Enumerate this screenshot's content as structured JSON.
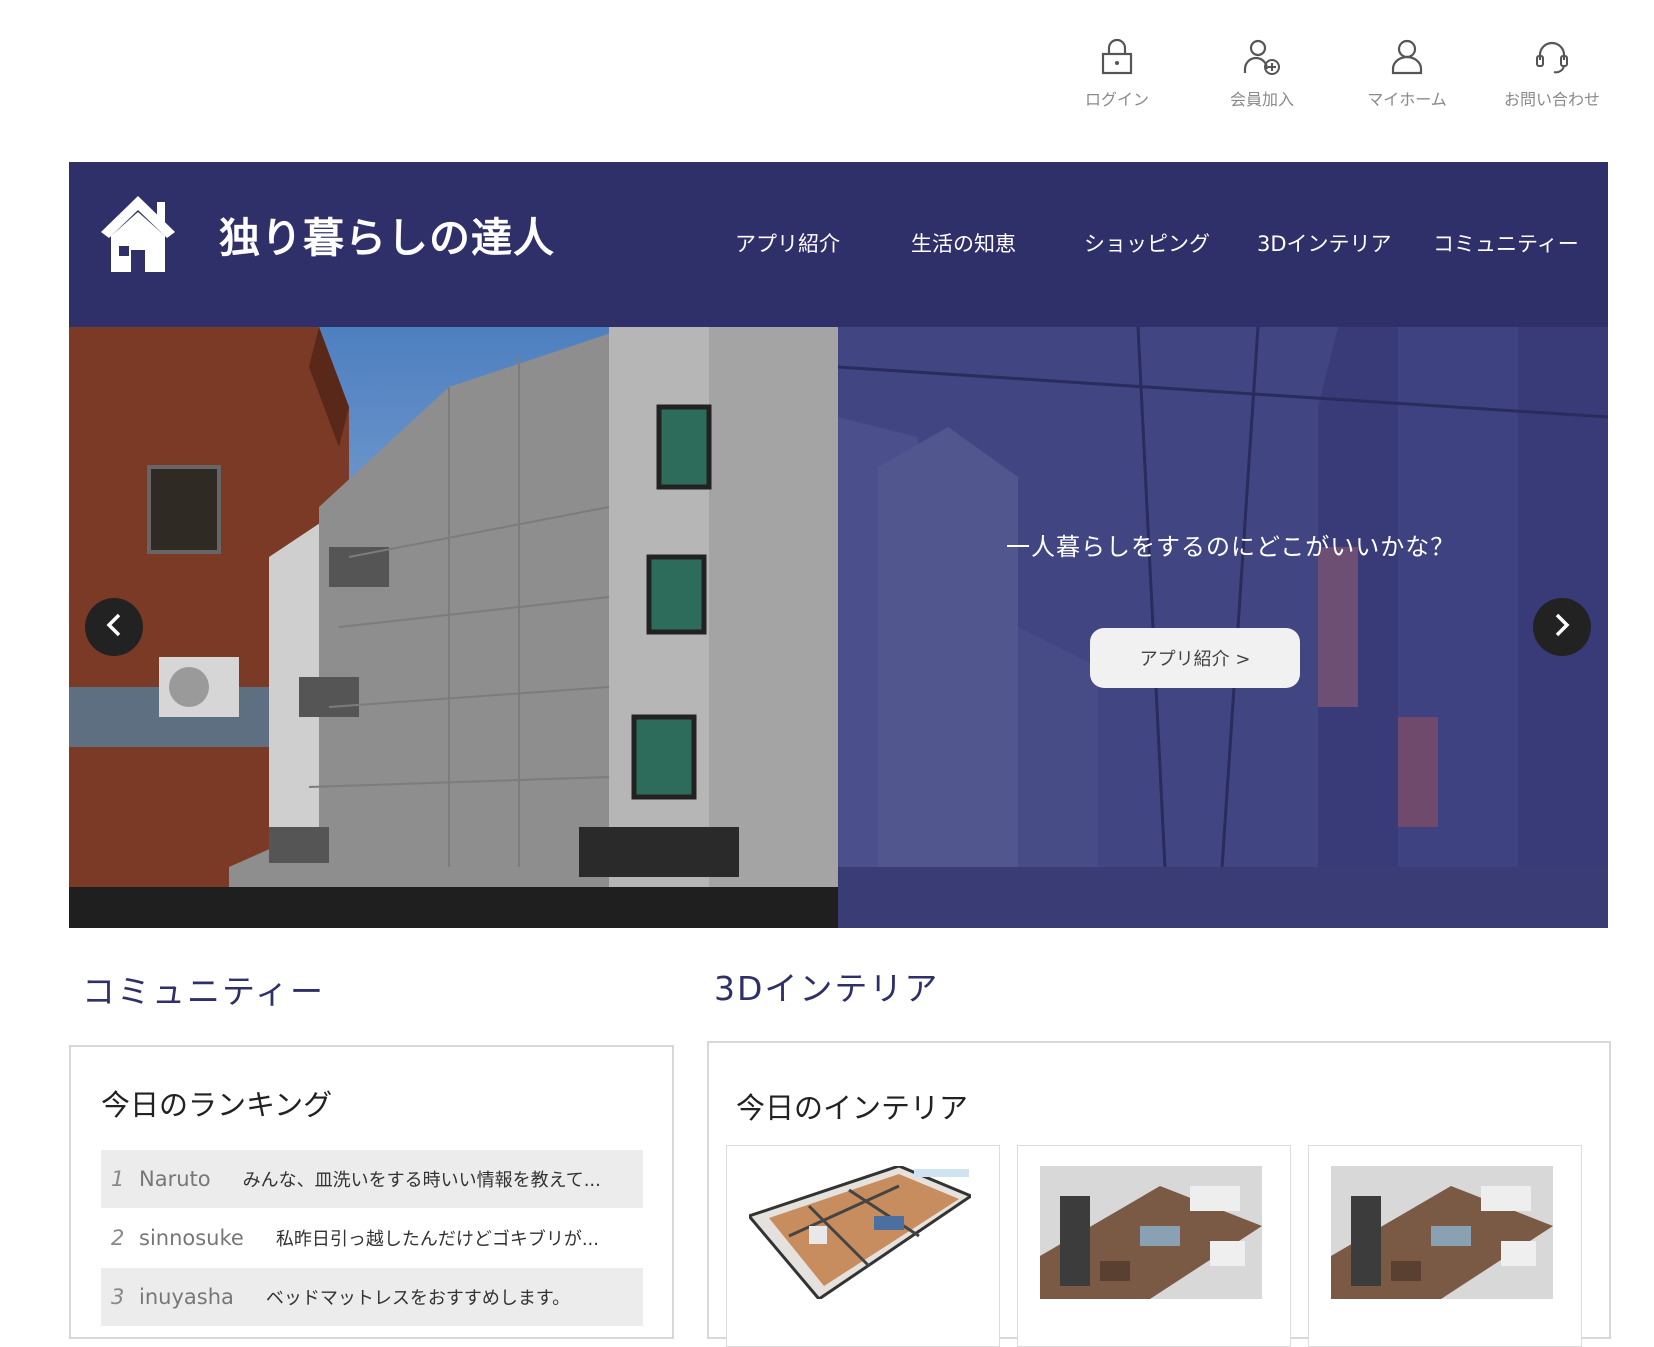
{
  "utility": {
    "login": {
      "label": "ログイン",
      "icon": "lock-icon"
    },
    "register": {
      "label": "会員加入",
      "icon": "user-plus-icon"
    },
    "myhome": {
      "label": "マイホーム",
      "icon": "user-icon"
    },
    "contact": {
      "label": "お問い合わせ",
      "icon": "headset-icon"
    }
  },
  "header": {
    "site_title": "独り暮らしの達人",
    "logo_icon": "house-icon",
    "nav": [
      "アプリ紹介",
      "生活の知恵",
      "ショッピング",
      "3Dインテリア",
      "コミュニティー"
    ]
  },
  "hero": {
    "caption": "一人暮らしをするのにどこがいいかな？",
    "button_label": "アプリ紹介 >",
    "prev_icon": "chevron-left-icon",
    "next_icon": "chevron-right-icon"
  },
  "community": {
    "section_title": "コミュニティー",
    "panel_title": "今日のランキング",
    "ranking": [
      {
        "rank": "1",
        "user": "Naruto",
        "text": "みんな、皿洗いをする時いい情報を教えて..."
      },
      {
        "rank": "2",
        "user": "sinnosuke",
        "text": "私昨日引っ越したんだけどゴキブリが..."
      },
      {
        "rank": "3",
        "user": "inuyasha",
        "text": "ベッドマットレスをおすすめします。"
      }
    ]
  },
  "interior": {
    "section_title": "3Dインテリア",
    "panel_title": "今日のインテリア"
  },
  "colors": {
    "header_bg": "#2f2f6a",
    "hero_overlay": "#3b3f8c",
    "section_title": "#2f2f6a"
  }
}
